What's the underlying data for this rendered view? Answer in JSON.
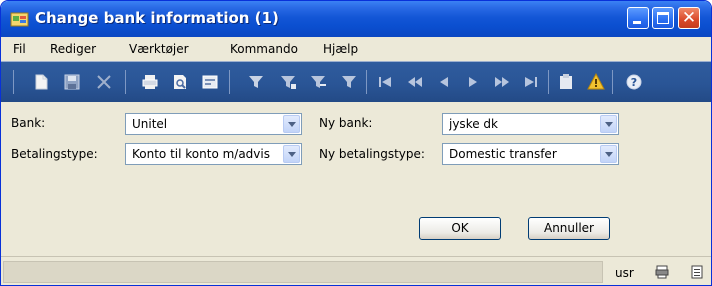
{
  "window": {
    "title": "Change bank information (1)",
    "title_bar_color": "#0b4fd0"
  },
  "menu": [
    {
      "label": "Fil"
    },
    {
      "label": "Rediger"
    },
    {
      "label": "Værktøjer"
    },
    {
      "label": "Kommando"
    },
    {
      "label": "Hjælp"
    }
  ],
  "toolbar": {
    "icons": [
      "new-icon",
      "save-icon",
      "delete-icon",
      "print-icon",
      "print-preview-icon",
      "export-icon",
      "filter-icon",
      "filter-selection-icon",
      "advanced-filter-icon",
      "remove-filter-icon",
      "first-record-icon",
      "previous-page-icon",
      "previous-record-icon",
      "next-record-icon",
      "next-page-icon",
      "last-record-icon",
      "attach-icon",
      "alert-icon",
      "help-icon"
    ]
  },
  "form": {
    "bank_label": "Bank:",
    "bank_value": "Unitel",
    "payment_type_label": "Betalingstype:",
    "payment_type_value": "Konto til konto m/advis",
    "new_bank_label": "Ny bank:",
    "new_bank_value": "jyske dk",
    "new_payment_type_label": "Ny betalingstype:",
    "new_payment_type_value": "Domestic transfer"
  },
  "buttons": {
    "ok": "OK",
    "cancel": "Annuller"
  },
  "status": {
    "user": "usr"
  }
}
